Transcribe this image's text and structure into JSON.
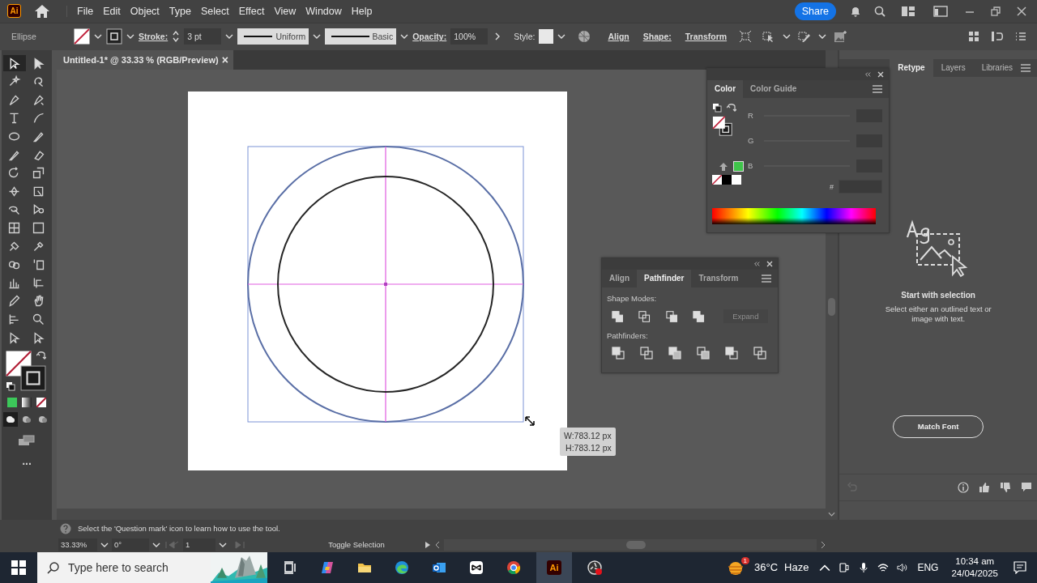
{
  "app": {
    "logo": "Ai"
  },
  "menu": [
    "File",
    "Edit",
    "Object",
    "Type",
    "Select",
    "Effect",
    "View",
    "Window",
    "Help"
  ],
  "share": "Share",
  "control_bar": {
    "tool": "Ellipse",
    "stroke_label": "Stroke:",
    "stroke_value": "3 pt",
    "profile": "Uniform",
    "brush": "Basic",
    "opacity_label": "Opacity:",
    "opacity_value": "100%",
    "style_label": "Style:",
    "links": [
      "Align",
      "Shape:",
      "Transform"
    ]
  },
  "document_tab": {
    "title": "Untitled-1* @ 33.33 % (RGB/Preview)",
    "close": "×"
  },
  "tools": [
    {
      "selected": true
    },
    {
      "selected": false
    },
    {
      "selected": false
    },
    {
      "selected": false
    },
    {
      "selected": false
    },
    {
      "selected": false
    },
    {
      "selected": false
    },
    {
      "selected": false
    },
    {
      "selected": false
    },
    {
      "selected": false
    },
    {
      "selected": false
    },
    {
      "selected": false
    },
    {
      "selected": false
    },
    {
      "selected": false
    },
    {
      "selected": false
    },
    {
      "selected": false
    },
    {
      "selected": false
    },
    {
      "selected": false
    },
    {
      "selected": false
    },
    {
      "selected": false
    },
    {
      "selected": false
    },
    {
      "selected": false
    },
    {
      "selected": false
    },
    {
      "selected": false
    },
    {
      "selected": false
    },
    {
      "selected": false
    },
    {
      "selected": false
    },
    {
      "selected": false
    },
    {
      "selected": false
    },
    {
      "selected": false
    },
    {
      "selected": false
    },
    {
      "selected": false
    }
  ],
  "draw_modes": [
    {
      "selected": true
    },
    {
      "selected": false
    },
    {
      "selected": false
    }
  ],
  "more_tools": "...",
  "tooltip": {
    "width": "W:783.12 px",
    "height": "H:783.12 px"
  },
  "color_panel": {
    "tabs": [
      {
        "label": "Color",
        "selected": true
      },
      {
        "label": "Color Guide",
        "selected": false
      }
    ],
    "channels": [
      "R",
      "G",
      "B"
    ],
    "hex_label": "#"
  },
  "pathfinder_panel": {
    "tabs": [
      {
        "label": "Align",
        "selected": false
      },
      {
        "label": "Pathfinder",
        "selected": true
      },
      {
        "label": "Transform",
        "selected": false
      }
    ],
    "shape_modes_label": "Shape Modes:",
    "expand": "Expand",
    "expand_disabled": true,
    "pathfinders_label": "Pathfinders:"
  },
  "right_panel": {
    "tabs": [
      {
        "label": "Retype",
        "selected": true
      },
      {
        "label": "Layers",
        "selected": false
      },
      {
        "label": "Libraries",
        "selected": false
      }
    ],
    "title": "Start with selection",
    "body": "Select either an outlined text or image with text.",
    "button": "Match Font"
  },
  "status": {
    "hint": "Select the 'Question mark' icon to learn how to use the tool.",
    "zoom": "33.33%",
    "rotation": "0°",
    "artboard": "1",
    "toggle": "Toggle Selection"
  },
  "taskbar": {
    "search_placeholder": "Type here to search",
    "weather_badge": "1",
    "temperature": "36°C",
    "condition": "Haze",
    "app_icon": "Ai",
    "language": "ENG",
    "time": "10:34 am",
    "date": "24/04/2025"
  }
}
